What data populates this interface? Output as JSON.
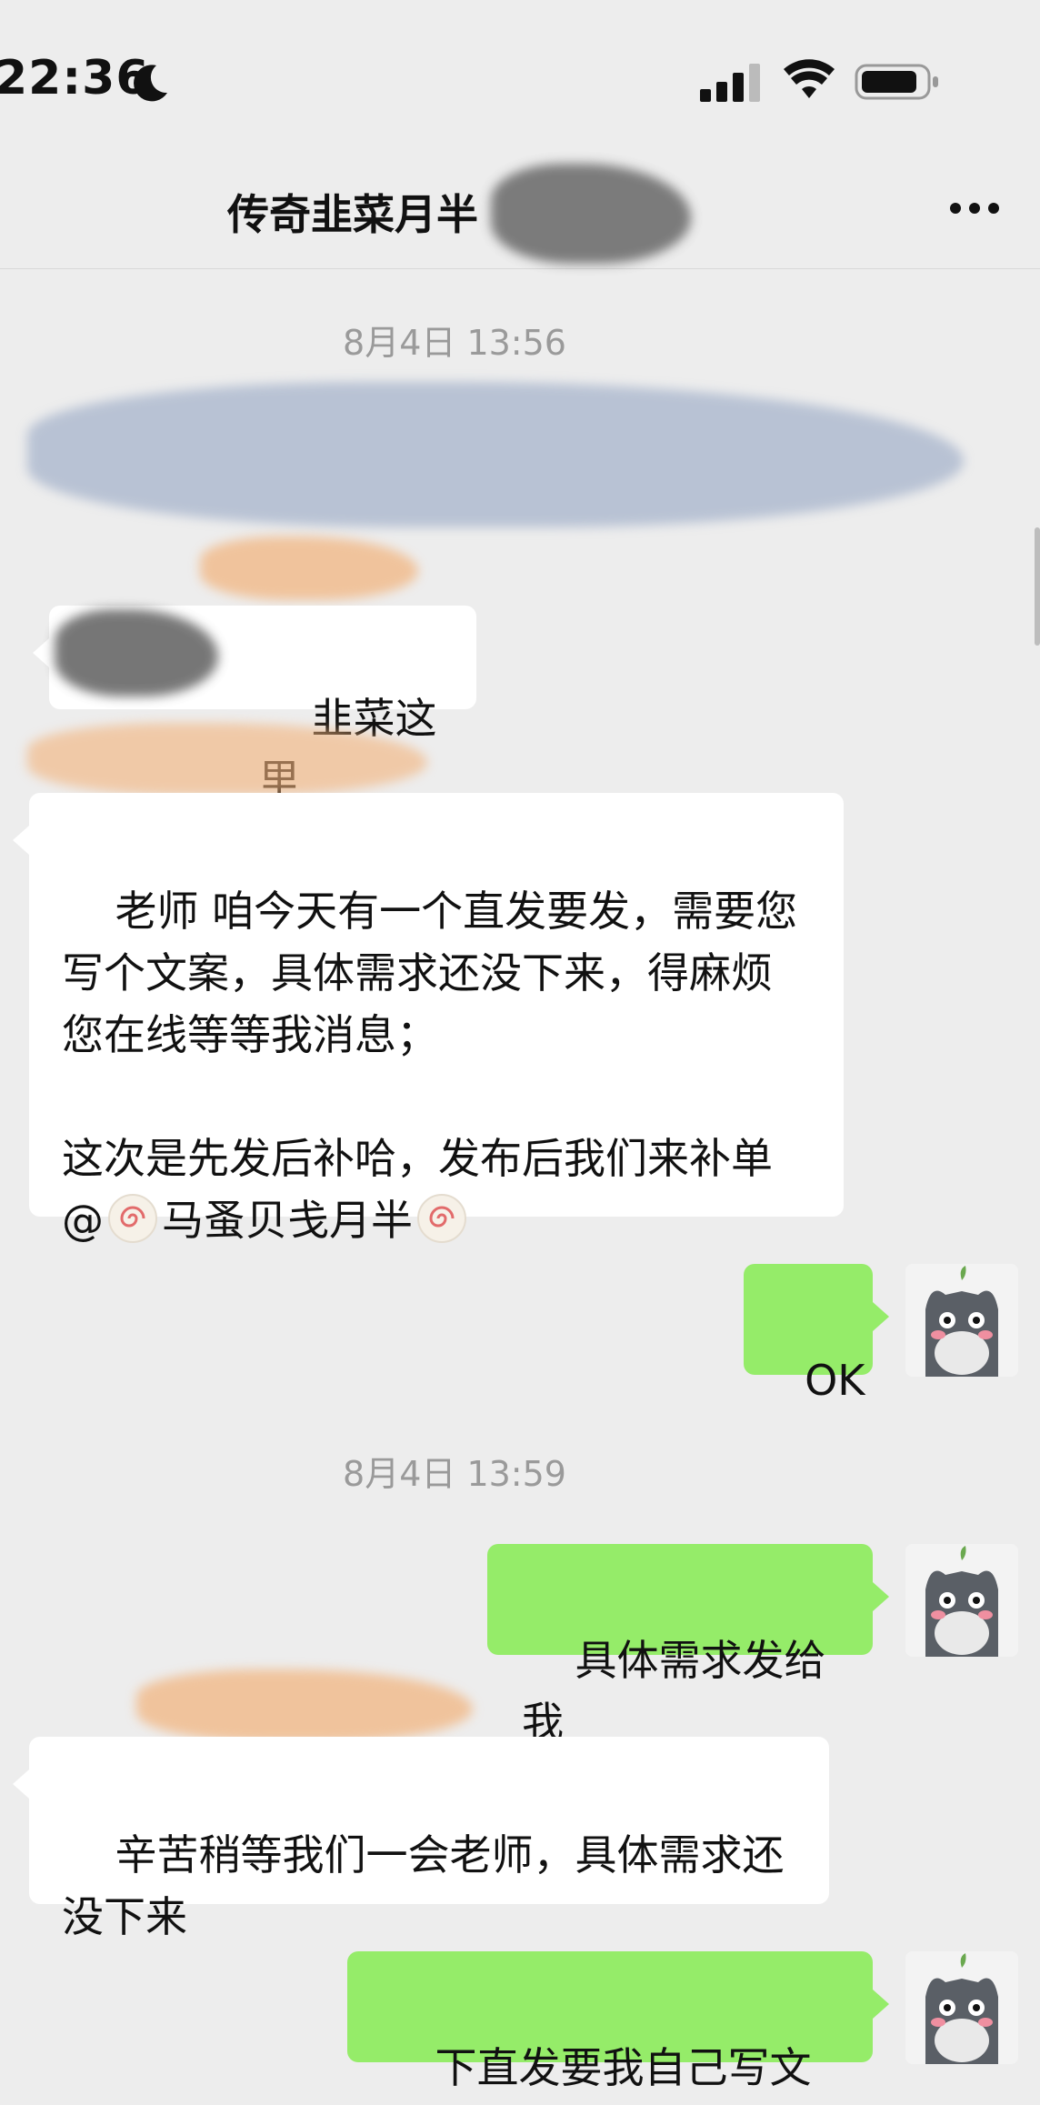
{
  "status_bar": {
    "time": "22:36"
  },
  "header": {
    "title": "传奇韭菜月半"
  },
  "messages": [
    {
      "type": "timestamp",
      "text": "8月4日 13:56"
    },
    {
      "type": "left",
      "text": "韭菜这里"
    },
    {
      "type": "left",
      "text_part1": "老师 咱今天有一个直发要发，需要您写个文案，具体需求还没下来，得麻烦您在线等等我消息；\n\n这次是先发后补哈，发布后我们来补单 @",
      "mention_name": "马蚤贝戋月半"
    },
    {
      "type": "right",
      "text": "OK"
    },
    {
      "type": "timestamp",
      "text": "8月4日 13:59"
    },
    {
      "type": "right",
      "text": "具体需求发给我"
    },
    {
      "type": "left",
      "text": "辛苦稍等我们一会老师，具体需求还没下来"
    },
    {
      "type": "right",
      "text": "下直发要我自己写文吗"
    }
  ],
  "icons": {
    "moon": "moon-icon",
    "signal": "signal-icon",
    "wifi": "wifi-icon",
    "battery": "battery-icon",
    "more": "more-icon",
    "emoji": "swirl-emoji-icon"
  },
  "colors": {
    "background": "#ededed",
    "outgoing_bubble": "#95ec69",
    "incoming_bubble": "#ffffff"
  }
}
